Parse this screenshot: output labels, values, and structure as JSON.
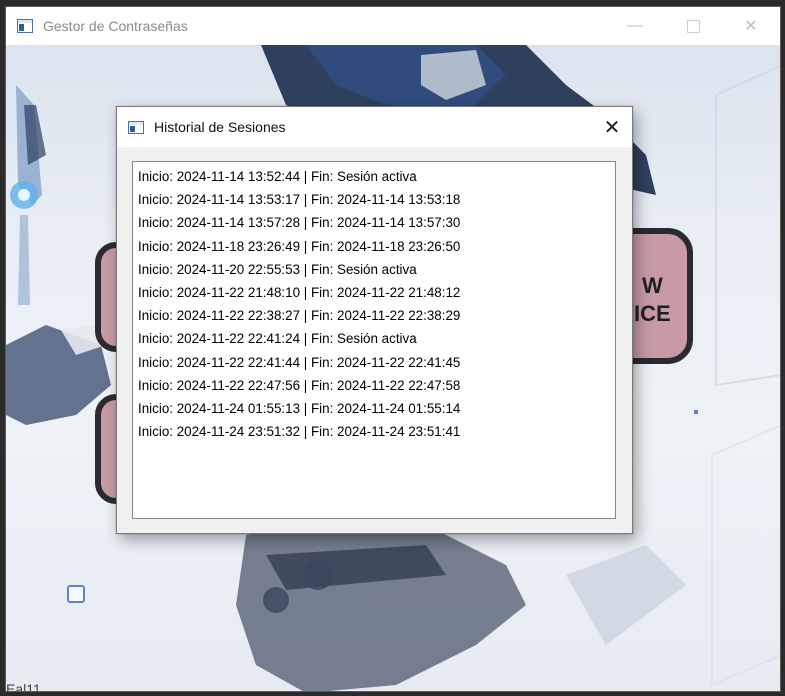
{
  "main_window": {
    "title": "Gestor de Contraseñas",
    "controls": {
      "minimize": "—",
      "close": "✕"
    }
  },
  "background": {
    "button_a_text_line1": "W",
    "button_a_text_line2": "ICE",
    "corner_text": "Eal11"
  },
  "dialog": {
    "title": "Historial de Sesiones",
    "close_glyph": "✕",
    "sessions": [
      "Inicio: 2024-11-14 13:52:44 | Fin: Sesión activa",
      "Inicio: 2024-11-14 13:53:17 | Fin: 2024-11-14 13:53:18",
      "Inicio: 2024-11-14 13:57:28 | Fin: 2024-11-14 13:57:30",
      "Inicio: 2024-11-18 23:26:49 | Fin: 2024-11-18 23:26:50",
      "Inicio: 2024-11-20 22:55:53 | Fin: Sesión activa",
      "Inicio: 2024-11-22 21:48:10 | Fin: 2024-11-22 21:48:12",
      "Inicio: 2024-11-22 22:38:27 | Fin: 2024-11-22 22:38:29",
      "Inicio: 2024-11-22 22:41:24 | Fin: Sesión activa",
      "Inicio: 2024-11-22 22:41:44 | Fin: 2024-11-22 22:41:45",
      "Inicio: 2024-11-22 22:47:56 | Fin: 2024-11-22 22:47:58",
      "Inicio: 2024-11-24 01:55:13 | Fin: 2024-11-24 01:55:14",
      "Inicio: 2024-11-24 23:51:32 | Fin: 2024-11-24 23:51:41"
    ]
  },
  "colors": {
    "dialog_bg": "#f0f0f0",
    "listbox_border": "#828790",
    "button_fill": "#c79aa6",
    "button_border": "#2a2a30"
  }
}
